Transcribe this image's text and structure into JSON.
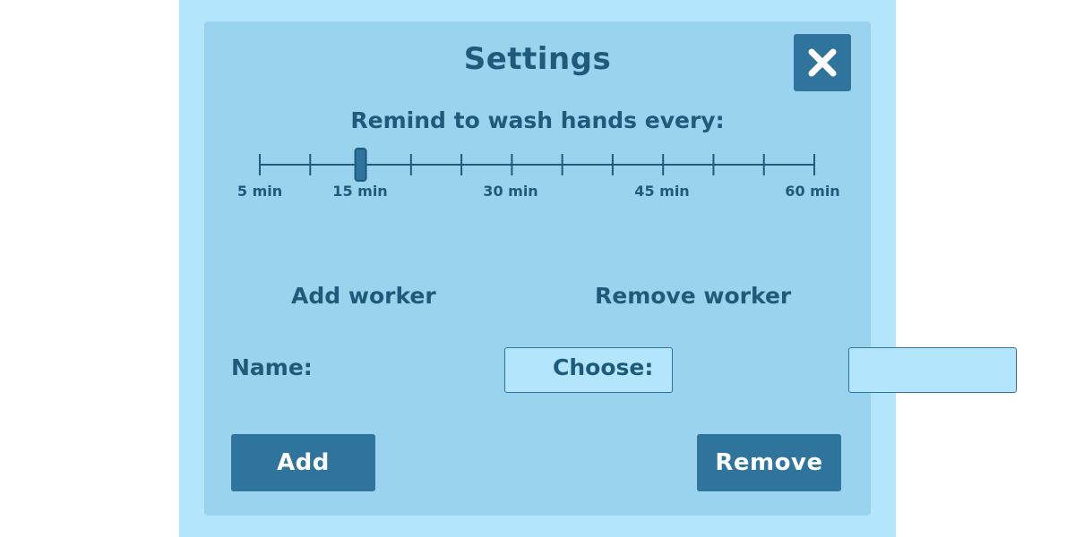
{
  "settings": {
    "title": "Settings",
    "close_icon": "close-x-icon"
  },
  "reminder": {
    "prompt": "Remind to wash hands every:",
    "slider": {
      "min_minutes": 5,
      "max_minutes": 60,
      "step_minutes": 5,
      "selected_minutes": 15,
      "tick_labels": [
        "5 min",
        "15 min",
        "30 min",
        "45 min",
        "60 min"
      ]
    }
  },
  "add_worker": {
    "heading": "Add worker",
    "field_label": "Name:",
    "field_value": "",
    "button_label": "Add"
  },
  "remove_worker": {
    "heading": "Remove worker",
    "field_label": "Choose:",
    "field_value": "",
    "button_label": "Remove"
  },
  "colors": {
    "outer_background": "#b3e5fc",
    "panel_background": "#9ad3ee",
    "text": "#1e5a7a",
    "button": "#2f749c",
    "button_text": "#ffffff"
  }
}
